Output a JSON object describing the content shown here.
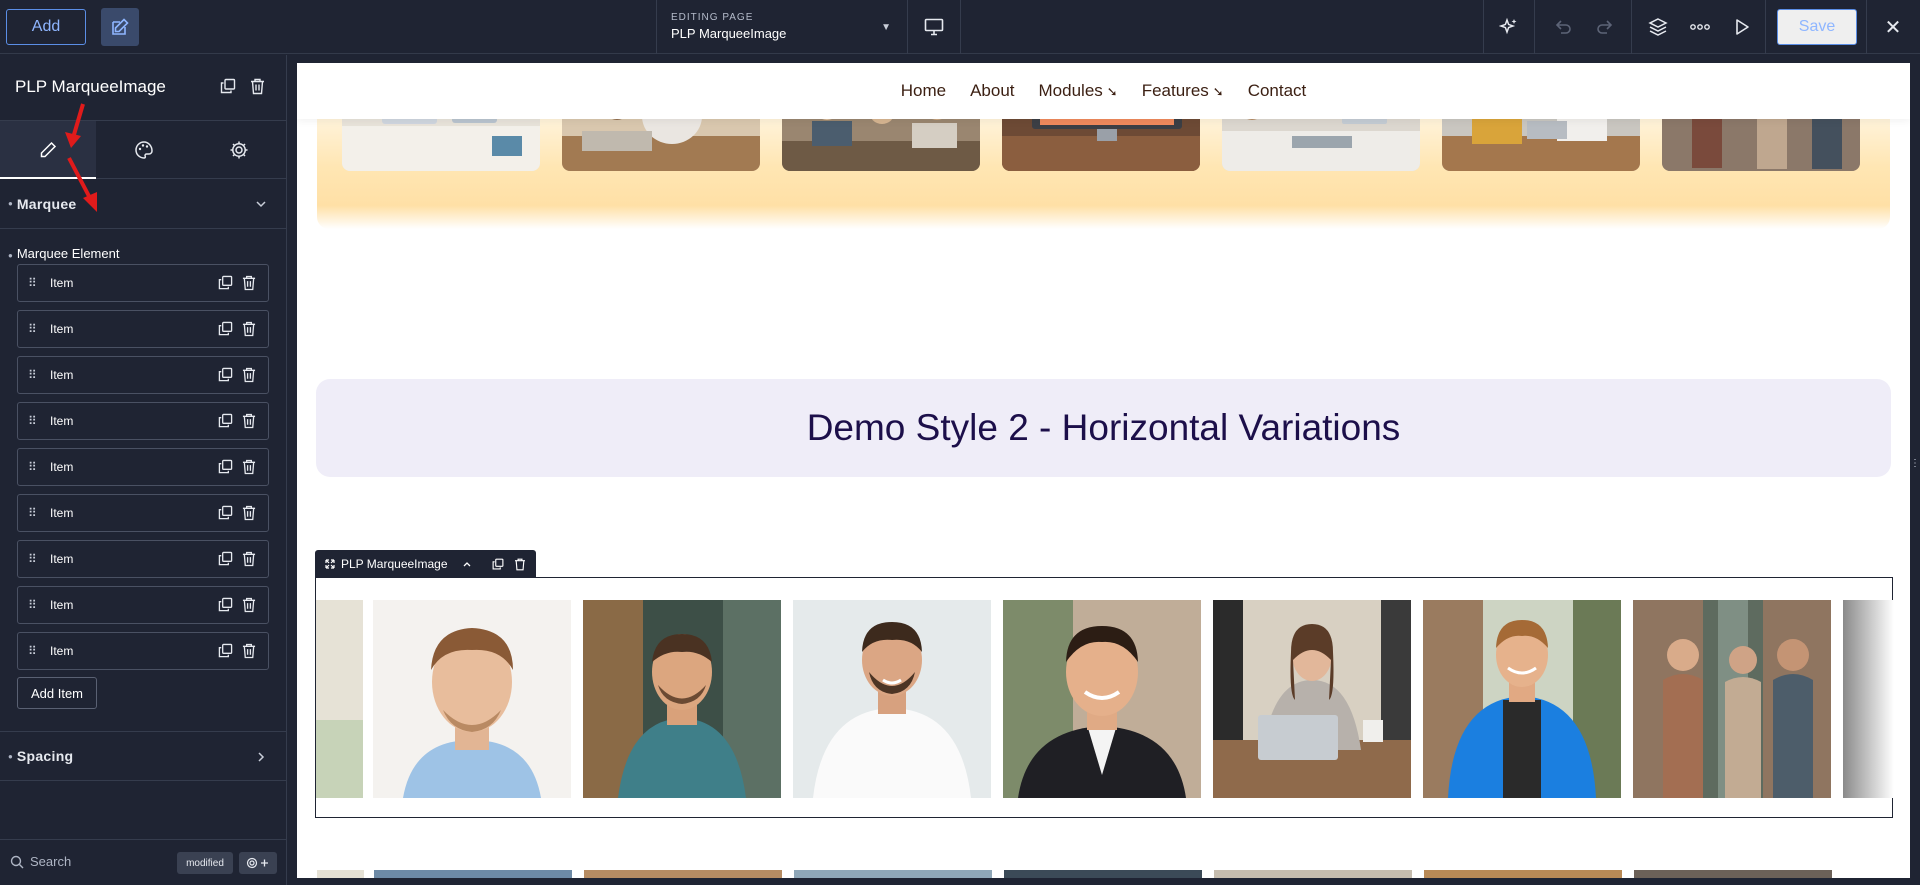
{
  "topbar": {
    "add_label": "Add",
    "editing_caption": "EDITING PAGE",
    "page_name": "PLP MarqueeImage",
    "save_label": "Save",
    "close_glyph": "✕"
  },
  "sidebar": {
    "title": "PLP MarqueeImage",
    "sections": {
      "marquee": "Marquee",
      "spacing": "Spacing"
    },
    "group_label": "Marquee Element",
    "items": [
      {
        "label": "Item"
      },
      {
        "label": "Item"
      },
      {
        "label": "Item"
      },
      {
        "label": "Item"
      },
      {
        "label": "Item"
      },
      {
        "label": "Item"
      },
      {
        "label": "Item"
      },
      {
        "label": "Item"
      },
      {
        "label": "Item"
      }
    ],
    "add_item_label": "Add Item",
    "search_placeholder": "Search",
    "modified_badge": "modified"
  },
  "site": {
    "nav": [
      {
        "label": "Home",
        "has_submenu": false
      },
      {
        "label": "About",
        "has_submenu": false
      },
      {
        "label": "Modules",
        "has_submenu": true
      },
      {
        "label": "Features",
        "has_submenu": true
      },
      {
        "label": "Contact",
        "has_submenu": false
      }
    ],
    "submenu_glyph": "➘",
    "heading": "Demo Style 2 - Horizontal Variations"
  },
  "module": {
    "label": "PLP MarqueeImage"
  },
  "colors": {
    "ui_bg": "#1f2433",
    "accent": "#5b8ee6",
    "heading_text": "#1c0f4a",
    "heading_bg": "#efedf8",
    "marquee_band": "#ffe0a6",
    "annotation_arrow": "#e01b1b"
  },
  "icons": {
    "edit": "pencil-square-icon",
    "desktop": "desktop-icon",
    "ai": "sparkle-icon",
    "undo": "undo-icon",
    "redo": "redo-icon",
    "layers": "layers-icon",
    "more": "more-dots-icon",
    "preview": "play-icon",
    "duplicate": "duplicate-icon",
    "delete": "trash-icon",
    "content_tab": "pencil-icon",
    "style_tab": "palette-icon",
    "settings_tab": "gear-icon",
    "drag": "drag-handle-icon",
    "search": "search-icon",
    "filter": "settings-plus-icon"
  }
}
